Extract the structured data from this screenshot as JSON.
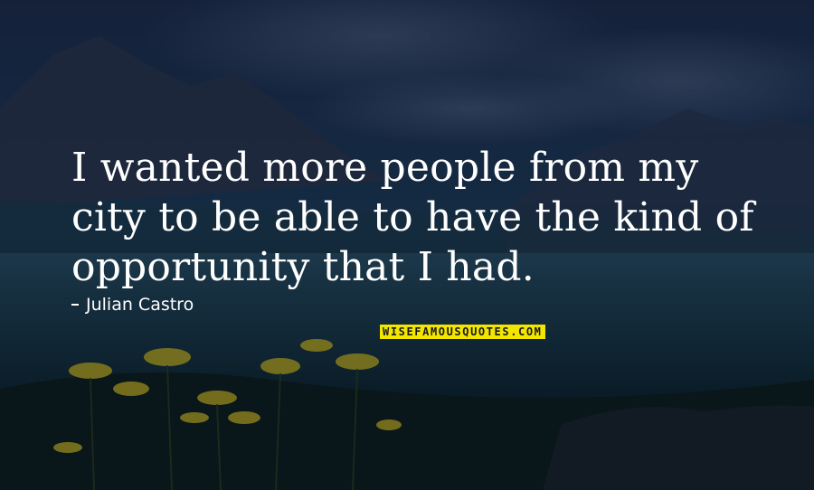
{
  "quote": {
    "lines": [
      "I wanted more people from my",
      "city to be able to have the kind of",
      "opportunity that I had."
    ]
  },
  "author": {
    "name": "Julian Castro"
  },
  "watermark": {
    "text": "WISEFAMOUSQUOTES.COM"
  },
  "colors": {
    "text": "#ffffff",
    "watermark_bg": "#f2e600",
    "sky": "#1c2a45",
    "flower": "#d9c21a"
  },
  "icons": {
    "author_dash": "dash-icon"
  }
}
